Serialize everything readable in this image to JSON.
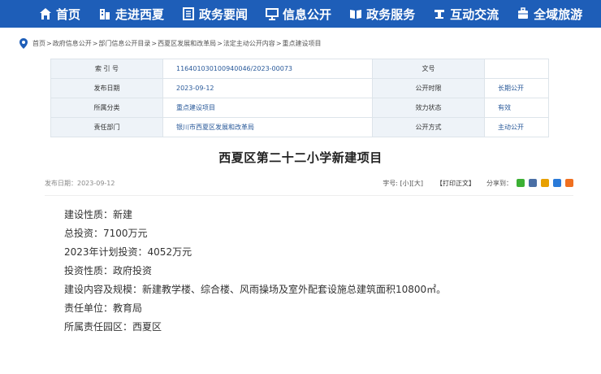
{
  "nav": {
    "items": [
      {
        "label": "首页",
        "icon": "home-icon"
      },
      {
        "label": "走进西夏",
        "icon": "building-icon"
      },
      {
        "label": "政务要闻",
        "icon": "news-icon"
      },
      {
        "label": "信息公开",
        "icon": "info-icon"
      },
      {
        "label": "政务服务",
        "icon": "service-icon"
      },
      {
        "label": "互动交流",
        "icon": "chat-icon"
      },
      {
        "label": "全域旅游",
        "icon": "travel-icon"
      }
    ]
  },
  "breadcrumb": {
    "items": [
      "首页",
      "政府信息公开",
      "部门信息公开目录",
      "西夏区发展和改革局",
      "法定主动公开内容",
      "重点建设项目"
    ],
    "sep": ">"
  },
  "meta": {
    "index_label": "索 引 号",
    "index_value": "116401030100940046/2023-00073",
    "doc_label": "文号",
    "doc_value": "",
    "pubdate_label": "发布日期",
    "pubdate_value": "2023-09-12",
    "opentime_label": "公开时限",
    "opentime_value": "长期公开",
    "category_label": "所属分类",
    "category_value": "重点建设项目",
    "status_label": "效力状态",
    "status_value": "有效",
    "dept_label": "责任部门",
    "dept_value": "银川市西夏区发展和改革局",
    "method_label": "公开方式",
    "method_value": "主动公开"
  },
  "article": {
    "title": "西夏区第二十二小学新建项目",
    "publish_date": "发布日期：2023-09-12",
    "font_size_label": "字号: [小][大]",
    "print_label": "【打印正文】",
    "share_label": "分享到：",
    "paragraphs": [
      "建设性质：新建",
      "总投资：7100万元",
      "2023年计划投资：4052万元",
      "投资性质：政府投资",
      "建设内容及规模：新建教学楼、综合楼、风雨操场及室外配套设施总建筑面积10800㎡。",
      "责任单位：教育局",
      "所属责任园区：西夏区"
    ]
  },
  "colors": {
    "nav_bg": "#1e5eb8",
    "link": "#2a5a9a"
  }
}
